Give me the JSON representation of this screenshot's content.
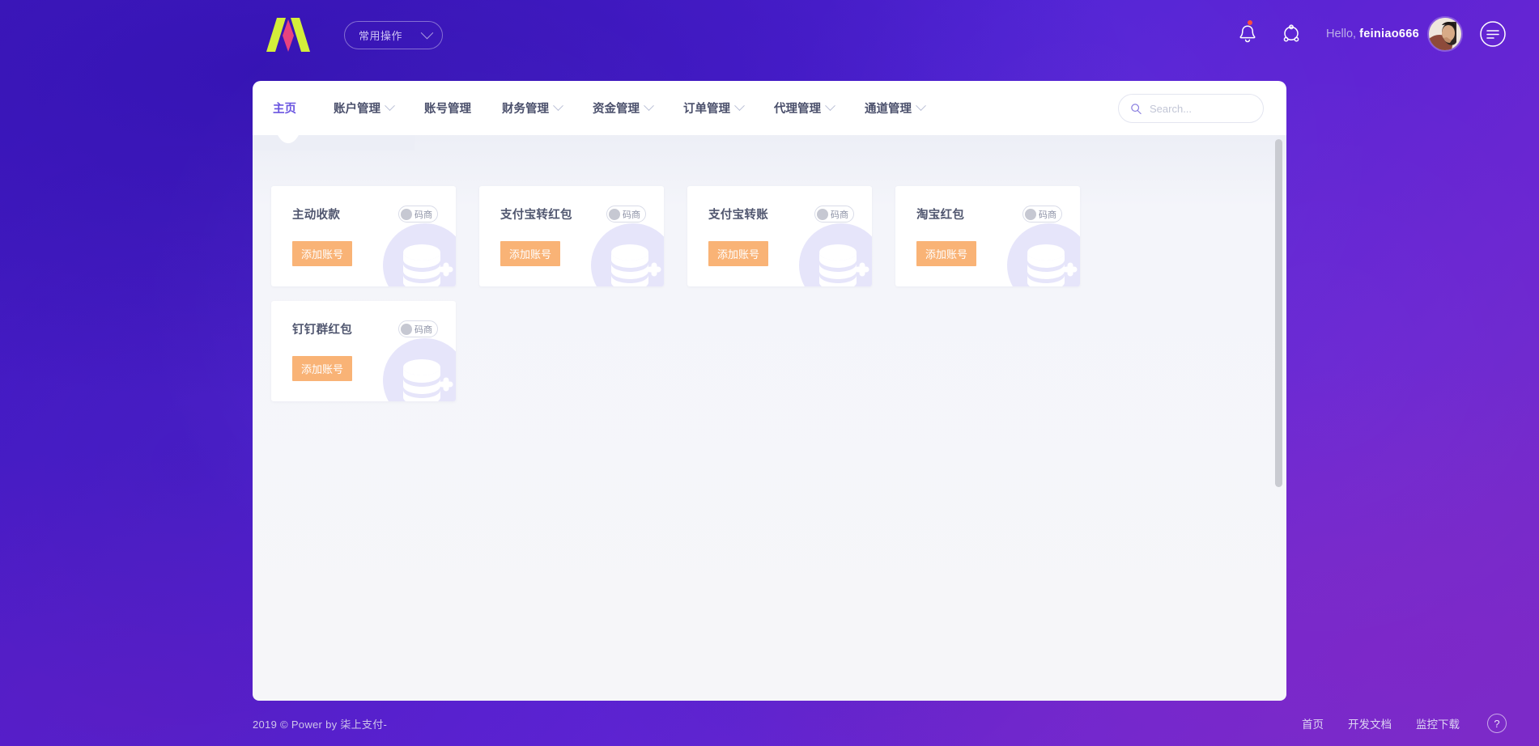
{
  "header": {
    "logo_name": "brand-logo-m",
    "quick_action": {
      "label": "常用操作",
      "caret": "chevron-down-icon"
    },
    "bell_icon": "bell-icon",
    "share_icon": "share-network-icon",
    "greeting": "Hello,",
    "username": "feiniao666",
    "avatar": "user-avatar",
    "menu_icon": "hamburger-menu-icon"
  },
  "nav": {
    "items": [
      {
        "label": "主页",
        "has_caret": false,
        "active": true
      },
      {
        "label": "账户管理",
        "has_caret": true,
        "active": false
      },
      {
        "label": "账号管理",
        "has_caret": false,
        "active": false
      },
      {
        "label": "财务管理",
        "has_caret": true,
        "active": false
      },
      {
        "label": "资金管理",
        "has_caret": true,
        "active": false
      },
      {
        "label": "订单管理",
        "has_caret": true,
        "active": false
      },
      {
        "label": "代理管理",
        "has_caret": true,
        "active": false
      },
      {
        "label": "通道管理",
        "has_caret": true,
        "active": false
      }
    ],
    "search": {
      "placeholder": "Search...",
      "value": "",
      "icon": "search-icon"
    }
  },
  "main": {
    "columns": [
      {
        "cards": [
          {
            "title": "主动收款",
            "toggle_label": "码商",
            "toggle_on": false,
            "button_label": "添加账号",
            "watermark": "coins-add-icon"
          },
          {
            "title": "钉钉群红包",
            "toggle_label": "码商",
            "toggle_on": false,
            "button_label": "添加账号",
            "watermark": "coins-add-icon"
          }
        ]
      },
      {
        "cards": [
          {
            "title": "支付宝转红包",
            "toggle_label": "码商",
            "toggle_on": false,
            "button_label": "添加账号",
            "watermark": "coins-add-icon"
          }
        ]
      },
      {
        "cards": [
          {
            "title": "支付宝转账",
            "toggle_label": "码商",
            "toggle_on": false,
            "button_label": "添加账号",
            "watermark": "coins-add-icon"
          }
        ]
      },
      {
        "cards": [
          {
            "title": "淘宝红包",
            "toggle_label": "码商",
            "toggle_on": false,
            "button_label": "添加账号",
            "watermark": "coins-add-icon"
          }
        ]
      }
    ]
  },
  "footer": {
    "copyright": "2019 © Power by 柒上支付-",
    "links": [
      {
        "label": "首页"
      },
      {
        "label": "开发文档"
      },
      {
        "label": "监控下载"
      }
    ],
    "help_label": "?"
  },
  "colors": {
    "accent_purple": "#6a55e0",
    "button_orange": "#f9b376",
    "bg_purple_dark": "#4018c0",
    "bg_purple_light": "#7a2ec8",
    "logo_green": "#d4ee3a",
    "logo_pink": "#e8437f"
  }
}
